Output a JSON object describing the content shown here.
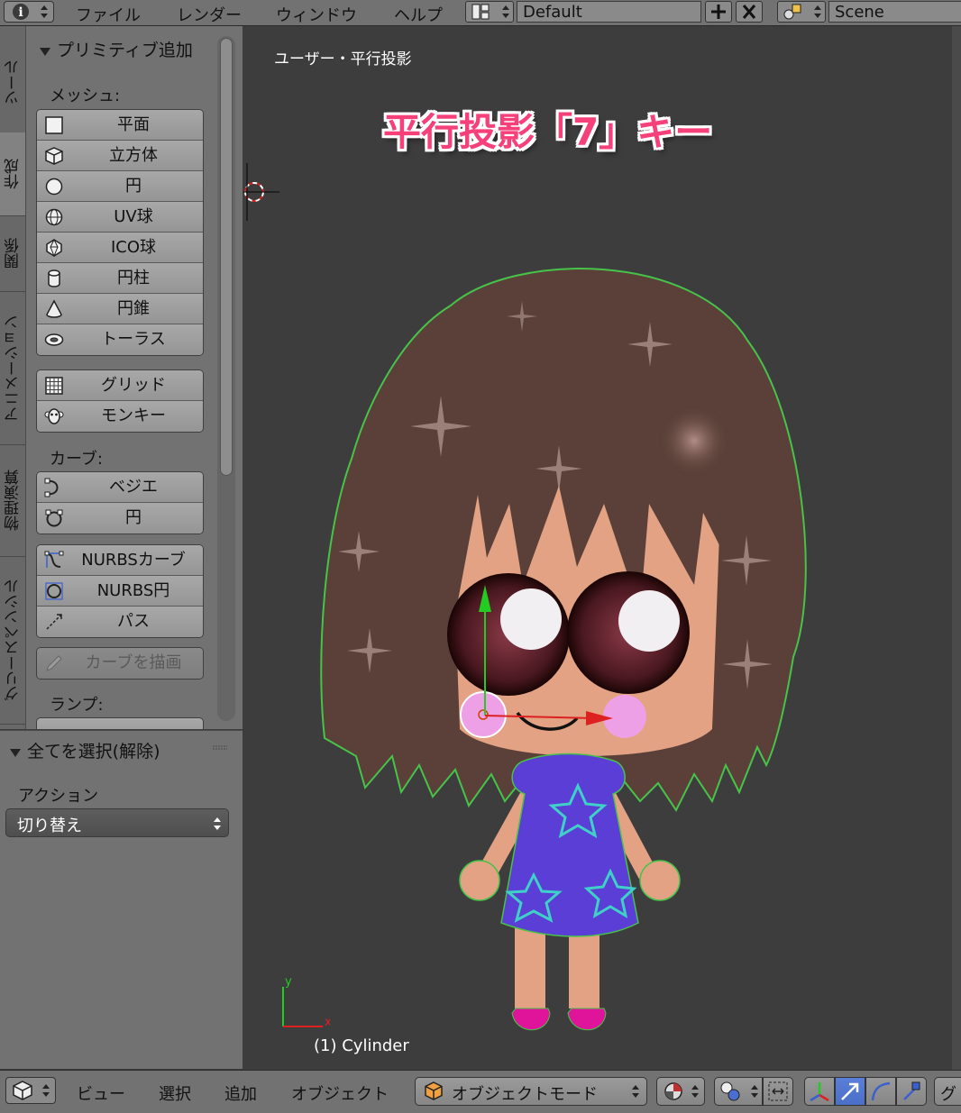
{
  "header": {
    "menus": [
      "ファイル",
      "レンダー",
      "ウィンドウ",
      "ヘルプ"
    ],
    "screen_layout": "Default",
    "scene": "Scene"
  },
  "tabs": [
    "ツール",
    "作成",
    "関係",
    "アニメーション",
    "物理演算",
    "グリースペンシル"
  ],
  "active_tab_index": 1,
  "tool_panel": {
    "title": "プリミティブ追加",
    "mesh_label": "メッシュ:",
    "mesh_group1": [
      {
        "label": "平面",
        "icon": "plane-icon"
      },
      {
        "label": "立方体",
        "icon": "cube-icon"
      },
      {
        "label": "円",
        "icon": "circle-icon"
      },
      {
        "label": "UV球",
        "icon": "uv-sphere-icon"
      },
      {
        "label": "ICO球",
        "icon": "ico-sphere-icon"
      },
      {
        "label": "円柱",
        "icon": "cylinder-icon"
      },
      {
        "label": "円錐",
        "icon": "cone-icon"
      },
      {
        "label": "トーラス",
        "icon": "torus-icon"
      }
    ],
    "mesh_group2": [
      {
        "label": "グリッド",
        "icon": "grid-icon"
      },
      {
        "label": "モンキー",
        "icon": "monkey-icon"
      }
    ],
    "curve_label": "カーブ:",
    "curve_group1": [
      {
        "label": "ベジエ",
        "icon": "bezier-icon"
      },
      {
        "label": "円",
        "icon": "curve-circle-icon"
      }
    ],
    "curve_group2": [
      {
        "label": "NURBSカーブ",
        "icon": "nurbs-curve-icon"
      },
      {
        "label": "NURBS円",
        "icon": "nurbs-circle-icon"
      },
      {
        "label": "パス",
        "icon": "path-icon"
      }
    ],
    "draw_curve_label": "カーブを描画",
    "lamp_label": "ランプ:"
  },
  "operator_panel": {
    "title": "全てを選択(解除)",
    "action_label": "アクション",
    "action_value": "切り替え"
  },
  "viewport": {
    "view_name": "ユーザー・平行投影",
    "overlay_caption": "平行投影「7」キー",
    "object_info": "(1) Cylinder",
    "axis_x": "x",
    "axis_y": "y"
  },
  "bottom_bar": {
    "menus": [
      "ビュー",
      "選択",
      "追加",
      "オブジェクト"
    ],
    "mode": "オブジェクトモード",
    "cut_text": "グ"
  },
  "colors": {
    "hair": "#5a4038",
    "skin": "#e2a283",
    "dress": "#5a3ed6",
    "star": "#3fd0c8",
    "cheek": "#eea0e6",
    "shoe": "#e0149a",
    "outline": "#47c34a",
    "caption_fill": "#f5407a"
  }
}
